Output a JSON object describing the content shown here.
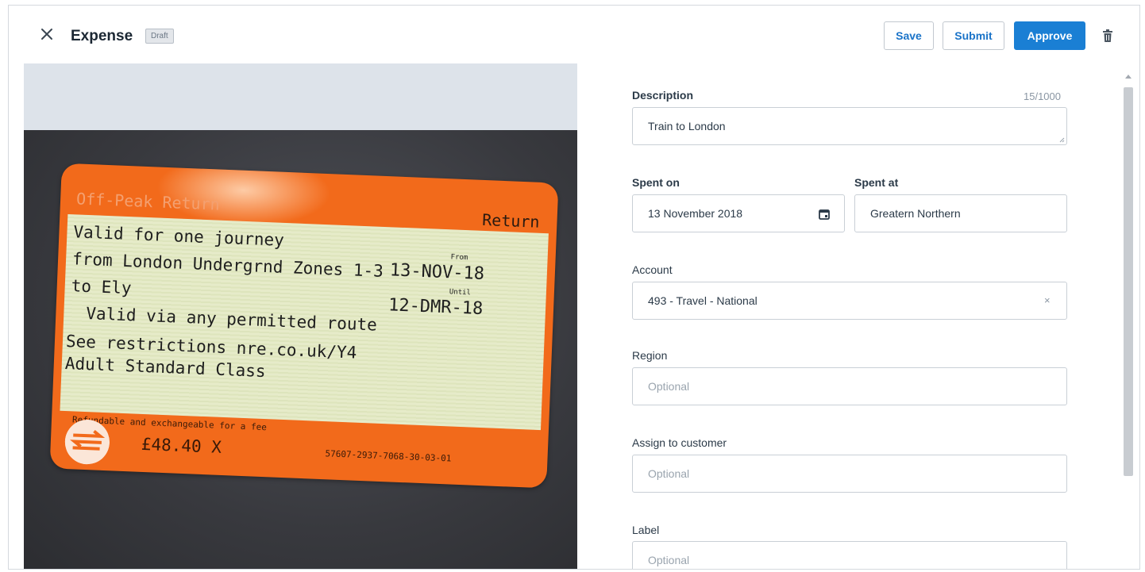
{
  "header": {
    "title": "Expense",
    "status_badge": "Draft",
    "buttons": {
      "save": "Save",
      "submit": "Submit",
      "approve": "Approve"
    },
    "icons": {
      "close": "close-icon",
      "delete": "trash-icon"
    }
  },
  "receipt": {
    "ticket_type": "Off-Peak Return",
    "ticket_class": "Return",
    "lines": [
      "Valid for one journey",
      "from London Undergrnd Zones 1-3",
      "to  Ely",
      "Valid via any permitted route",
      "See restrictions nre.co.uk/Y4",
      "Adult Standard Class"
    ],
    "from_label": "From",
    "from_date": "13-NOV-18",
    "until_label": "Until",
    "until_date": "12-DMR-18",
    "refund_note": "Refundable and exchangeable for a fee",
    "price": "£48.40 X",
    "ticket_number": "57607-2937-7068-30-03-01",
    "colors": {
      "ticket_orange": "#f26a1b",
      "ticket_green": "#e6ebc9"
    }
  },
  "form": {
    "description": {
      "label": "Description",
      "counter": "15/1000",
      "value": "Train to London"
    },
    "spent_on": {
      "label": "Spent on",
      "value": "13 November 2018",
      "icon": "calendar-icon"
    },
    "spent_at": {
      "label": "Spent at",
      "value": "Greatern Northern"
    },
    "account": {
      "label": "Account",
      "value": "493 - Travel - National",
      "clear": "×"
    },
    "region": {
      "label": "Region",
      "placeholder": "Optional"
    },
    "assign_customer": {
      "label": "Assign to customer",
      "placeholder": "Optional"
    },
    "label_field": {
      "label": "Label",
      "placeholder": "Optional"
    }
  },
  "theme": {
    "primary": "#1a7fd4",
    "link": "#1a73c8"
  }
}
